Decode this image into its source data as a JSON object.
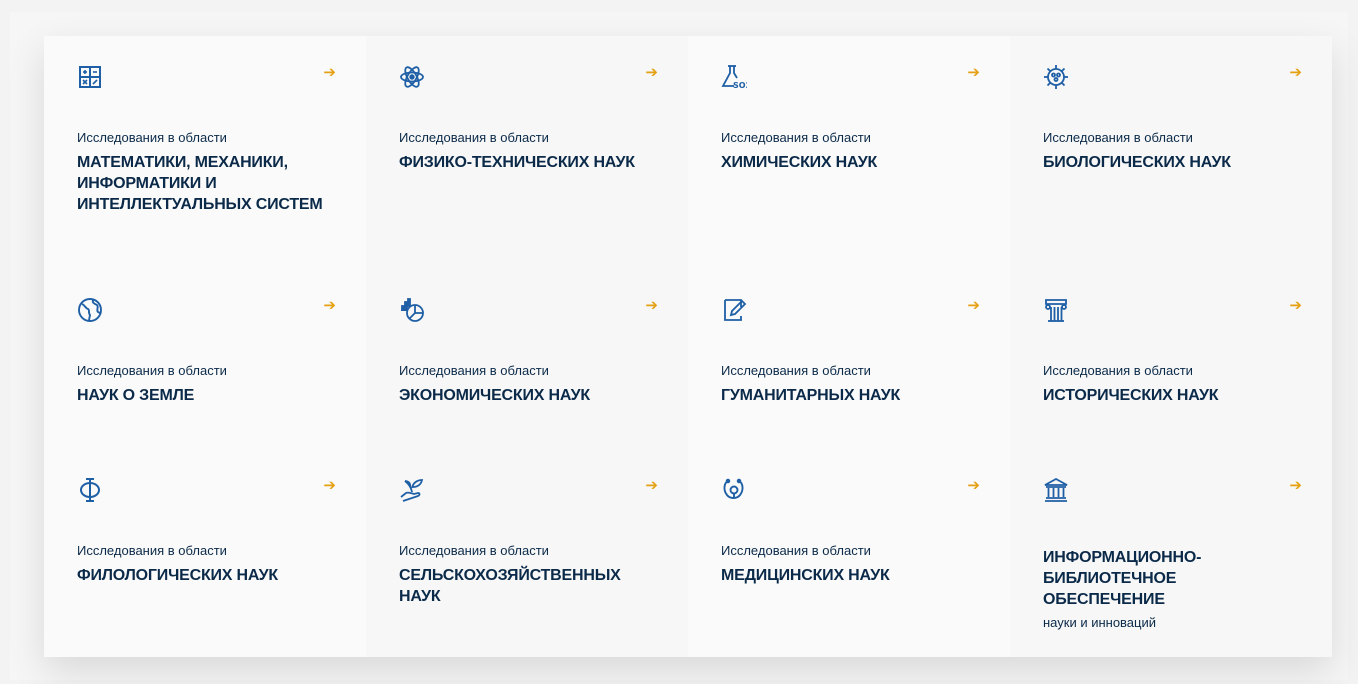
{
  "colors": {
    "accent": "#e5a114",
    "icon": "#1f5fa6",
    "text": "#0b2a49"
  },
  "cards": [
    {
      "icon": "calculator-icon",
      "pre": "Исследования в области",
      "title": "МАТЕМАТИКИ, МЕХАНИКИ,\nИНФОРМАТИКИ И\nИНТЕЛЛЕКТУАЛЬНЫХ СИСТЕМ"
    },
    {
      "icon": "atom-icon",
      "pre": "Исследования в области",
      "title": "ФИЗИКО-ТЕХНИЧЕСКИХ НАУК"
    },
    {
      "icon": "flask-icon",
      "pre": "Исследования в области",
      "title": "ХИМИЧЕСКИХ НАУК"
    },
    {
      "icon": "gear-cells-icon",
      "pre": "Исследования в области",
      "title": "БИОЛОГИЧЕСКИХ  НАУК"
    },
    {
      "icon": "globe-icon",
      "pre": "Исследования в области",
      "title": "НАУК О ЗЕМЛЕ"
    },
    {
      "icon": "economy-chart-icon",
      "pre": "Исследования в области",
      "title": "ЭКОНОМИЧЕСКИХ НАУК"
    },
    {
      "icon": "pen-paper-icon",
      "pre": "Исследования в области",
      "title": "ГУМАНИТАРНЫХ НАУК"
    },
    {
      "icon": "column-icon",
      "pre": "Исследования в области",
      "title": "ИСТОРИЧЕСКИХ НАУК"
    },
    {
      "icon": "phi-letter-icon",
      "pre": "Исследования в области",
      "title": "ФИЛОЛОГИЧЕСКИХ НАУК"
    },
    {
      "icon": "sprout-hand-icon",
      "pre": "Исследования в области",
      "title": "СЕЛЬСКОХОЗЯЙСТВЕННЫХ\nНАУК"
    },
    {
      "icon": "stethoscope-icon",
      "pre": "Исследования в области",
      "title": "МЕДИЦИНСКИХ НАУК"
    },
    {
      "icon": "library-building-icon",
      "pre": "",
      "title": "ИНФОРМАЦИОННО-\nБИБЛИОТЕЧНОЕ ОБЕСПЕЧЕНИЕ",
      "sub": "науки и инноваций"
    }
  ],
  "arrow_glyph": "➔"
}
